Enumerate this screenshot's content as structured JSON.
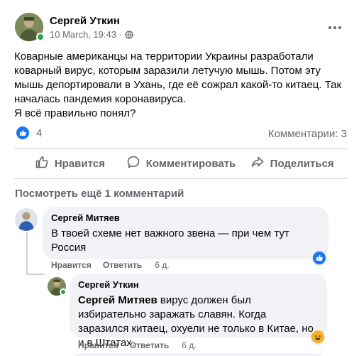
{
  "post": {
    "author": "Сергей Уткин",
    "date": "10 March, 19:43",
    "meta_dot": "·",
    "text": [
      "Коварные американцы на территории Украины разработали коварный вирус, которым заразили летучую мышь. Потом эту мышь депортировали в Ухань, где её сожрал какой-то китаец. Так началась пандемия коронавируса.",
      "Я всё правильно понял?"
    ],
    "reactions_count": "4",
    "comments_label": "Комментарии: 3"
  },
  "actions": {
    "like": "Нравится",
    "comment": "Комментировать",
    "share": "Поделиться"
  },
  "view_more": "Посмотреть ещё 1 комментарий",
  "comments": [
    {
      "name": "Сергей Митяев",
      "text": "В твоей схеме нет важного звена — при чем тут Россия",
      "like": "Нравится",
      "reply": "Ответить",
      "time": "6 д."
    },
    {
      "name": "Сергей Уткин",
      "mention": "Сергей Митяев",
      "text": " вирус должен был избирательно заражать славян. Когда заразился китаец, охуели не только в Китае, но и в Штатах.",
      "like": "Нравится",
      "reply": "Ответить",
      "time": "6 д."
    }
  ],
  "colors": {
    "like_blue": "#1877f2",
    "online_green": "#31a24c",
    "haha_yellow": "#f7b125"
  },
  "icons": [
    "globe-icon",
    "more-icon",
    "like-icon",
    "thumb-up-icon",
    "comment-icon",
    "share-icon",
    "haha-icon"
  ]
}
